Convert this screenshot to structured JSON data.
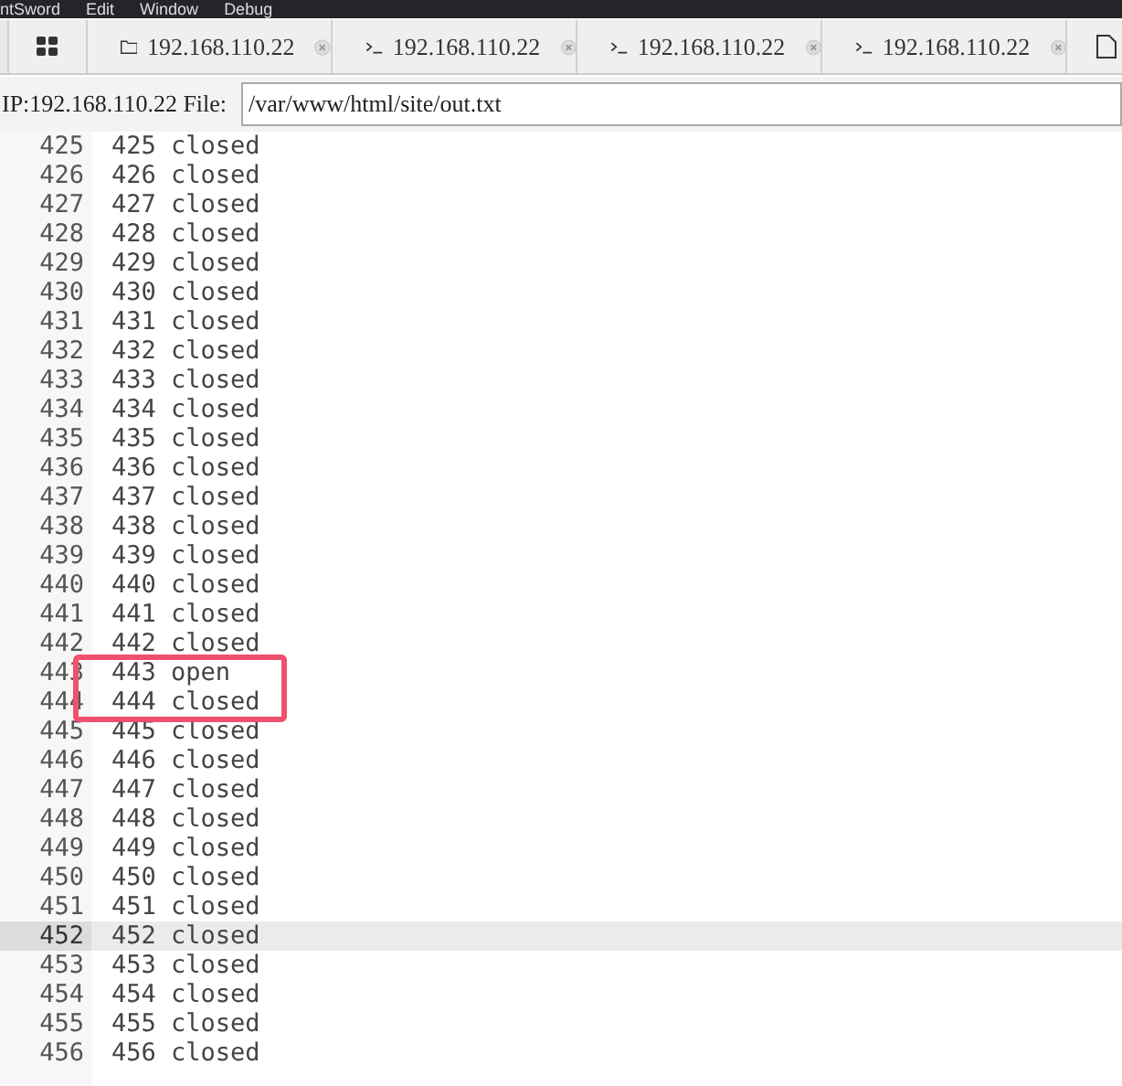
{
  "menu": [
    "ntSword",
    "Edit",
    "Window",
    "Debug"
  ],
  "tabs": [
    {
      "kind": "home"
    },
    {
      "kind": "folder",
      "label": "192.168.110.22"
    },
    {
      "kind": "terminal",
      "label": "192.168.110.22"
    },
    {
      "kind": "terminal",
      "label": "192.168.110.22"
    },
    {
      "kind": "terminal",
      "label": "192.168.110.22"
    },
    {
      "kind": "file"
    }
  ],
  "file_bar": {
    "label": "IP:192.168.110.22 File:",
    "path": "/var/www/html/site/out.txt"
  },
  "lines": [
    {
      "number": "425",
      "text": "425 closed",
      "active": false,
      "annotated": false
    },
    {
      "number": "426",
      "text": "426 closed",
      "active": false,
      "annotated": false
    },
    {
      "number": "427",
      "text": "427 closed",
      "active": false,
      "annotated": false
    },
    {
      "number": "428",
      "text": "428 closed",
      "active": false,
      "annotated": false
    },
    {
      "number": "429",
      "text": "429 closed",
      "active": false,
      "annotated": false
    },
    {
      "number": "430",
      "text": "430 closed",
      "active": false,
      "annotated": false
    },
    {
      "number": "431",
      "text": "431 closed",
      "active": false,
      "annotated": false
    },
    {
      "number": "432",
      "text": "432 closed",
      "active": false,
      "annotated": false
    },
    {
      "number": "433",
      "text": "433 closed",
      "active": false,
      "annotated": false
    },
    {
      "number": "434",
      "text": "434 closed",
      "active": false,
      "annotated": false
    },
    {
      "number": "435",
      "text": "435 closed",
      "active": false,
      "annotated": false
    },
    {
      "number": "436",
      "text": "436 closed",
      "active": false,
      "annotated": false
    },
    {
      "number": "437",
      "text": "437 closed",
      "active": false,
      "annotated": false
    },
    {
      "number": "438",
      "text": "438 closed",
      "active": false,
      "annotated": false
    },
    {
      "number": "439",
      "text": "439 closed",
      "active": false,
      "annotated": false
    },
    {
      "number": "440",
      "text": "440 closed",
      "active": false,
      "annotated": false
    },
    {
      "number": "441",
      "text": "441 closed",
      "active": false,
      "annotated": false
    },
    {
      "number": "442",
      "text": "442 closed",
      "active": false,
      "annotated": false
    },
    {
      "number": "443",
      "text": "443 open",
      "active": false,
      "annotated": true
    },
    {
      "number": "444",
      "text": "444 closed",
      "active": false,
      "annotated": true
    },
    {
      "number": "445",
      "text": "445 closed",
      "active": false,
      "annotated": false
    },
    {
      "number": "446",
      "text": "446 closed",
      "active": false,
      "annotated": false
    },
    {
      "number": "447",
      "text": "447 closed",
      "active": false,
      "annotated": false
    },
    {
      "number": "448",
      "text": "448 closed",
      "active": false,
      "annotated": false
    },
    {
      "number": "449",
      "text": "449 closed",
      "active": false,
      "annotated": false
    },
    {
      "number": "450",
      "text": "450 closed",
      "active": false,
      "annotated": false
    },
    {
      "number": "451",
      "text": "451 closed",
      "active": false,
      "annotated": false
    },
    {
      "number": "452",
      "text": "452 closed",
      "active": true,
      "annotated": false
    },
    {
      "number": "453",
      "text": "453 closed",
      "active": false,
      "annotated": false
    },
    {
      "number": "454",
      "text": "454 closed",
      "active": false,
      "annotated": false
    },
    {
      "number": "455",
      "text": "455 closed",
      "active": false,
      "annotated": false
    },
    {
      "number": "456",
      "text": "456 closed",
      "active": false,
      "annotated": false
    }
  ]
}
